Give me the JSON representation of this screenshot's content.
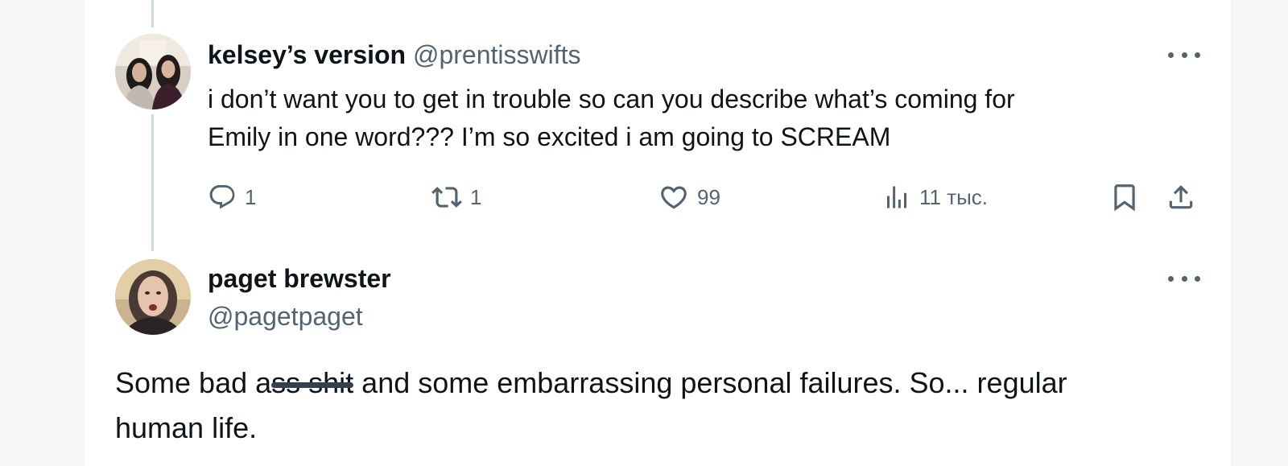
{
  "colors": {
    "text_primary": "#0f1419",
    "text_secondary": "#536471",
    "thread_line": "#cfd9de",
    "redaction_bar": "#33404f"
  },
  "tweet1": {
    "display_name": "kelsey’s version",
    "handle": "@prentisswifts",
    "avatar_icon": "avatar-two-women-photo",
    "text_line1": "i don’t want you to get in trouble so can you describe what’s coming for",
    "text_line2": "Emily in one word??? I’m so excited i am going to SCREAM",
    "actions": {
      "reply_icon": "reply-icon",
      "reply_count": "1",
      "retweet_icon": "retweet-icon",
      "retweet_count": "1",
      "like_icon": "heart-icon",
      "like_count": "99",
      "views_icon": "views-bar-chart-icon",
      "views_count": "11 тыс.",
      "bookmark_icon": "bookmark-icon",
      "share_icon": "share-icon"
    },
    "more_icon": "more-horizontal-icon"
  },
  "tweet2": {
    "display_name": "paget brewster",
    "handle": "@pagetpaget",
    "avatar_icon": "avatar-woman-photo",
    "text_before": "Some bad a",
    "text_redacted": "ss shit",
    "text_after": " and some embarrassing personal failures. So... regular",
    "text_line2": "human life.",
    "more_icon": "more-horizontal-icon"
  }
}
